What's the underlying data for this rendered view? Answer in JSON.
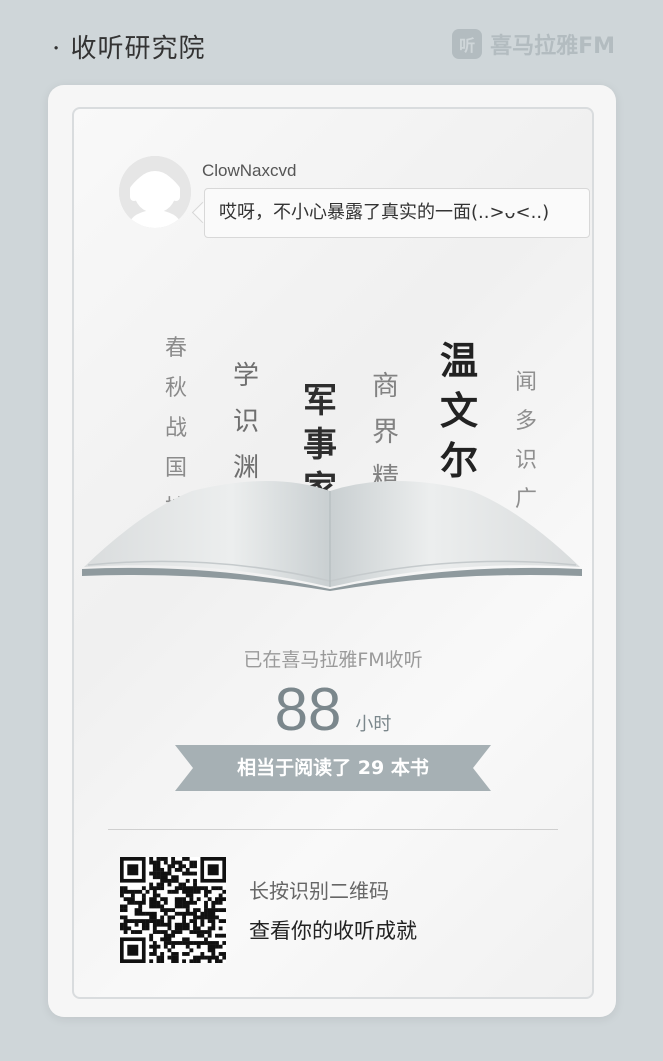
{
  "header": {
    "title": "· 收听研究院",
    "brand_icon_glyph": "听",
    "brand_name": "喜马拉雅FM"
  },
  "user": {
    "name": "ClowNaxcvd",
    "message": "哎呀，不小心暴露了真实的一面(..>ᴗ<..)"
  },
  "tags": [
    "春秋战国控",
    "学识渊博",
    "军事家",
    "商界精英",
    "温文尔雅",
    "闻多识广"
  ],
  "stats": {
    "caption": "已在喜马拉雅FM收听",
    "hours": "88",
    "hours_unit": "小时",
    "books_text": "相当于阅读了 29 本书"
  },
  "qr": {
    "hint_line1": "长按识别二维码",
    "hint_line2": "查看你的收听成就"
  },
  "colors": {
    "background": "#cfd6d9",
    "accent_gray": "#7b878c",
    "ribbon": "#a6b0b4"
  }
}
